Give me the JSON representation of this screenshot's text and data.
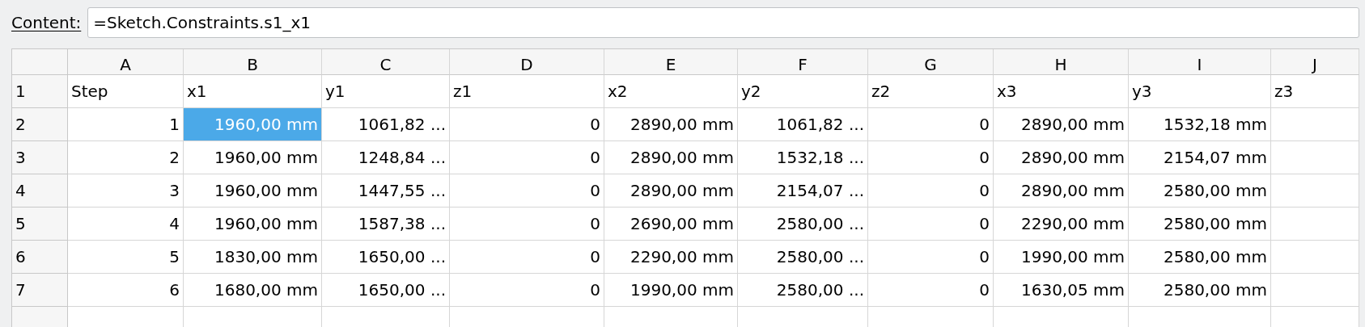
{
  "content_bar": {
    "label": "Content:",
    "value": "=Sketch.Constraints.s1_x1"
  },
  "table": {
    "columns": [
      "A",
      "B",
      "C",
      "D",
      "E",
      "F",
      "G",
      "H",
      "I",
      "J"
    ],
    "rows": [
      {
        "header": "1",
        "kind": "text",
        "cells": [
          {
            "text": "Step",
            "selected": false
          },
          {
            "text": "x1",
            "selected": false
          },
          {
            "text": "y1",
            "selected": false
          },
          {
            "text": "z1",
            "selected": false
          },
          {
            "text": "x2",
            "selected": false
          },
          {
            "text": "y2",
            "selected": false
          },
          {
            "text": "z2",
            "selected": false
          },
          {
            "text": "x3",
            "selected": false
          },
          {
            "text": "y3",
            "selected": false
          },
          {
            "text": "z3",
            "selected": false
          }
        ]
      },
      {
        "header": "2",
        "kind": "number",
        "cells": [
          {
            "text": "1",
            "selected": false
          },
          {
            "text": "1960,00 mm",
            "selected": true
          },
          {
            "text": "1061,82 ...",
            "selected": false
          },
          {
            "text": "0",
            "selected": false
          },
          {
            "text": "2890,00 mm",
            "selected": false
          },
          {
            "text": "1061,82 ...",
            "selected": false
          },
          {
            "text": "0",
            "selected": false
          },
          {
            "text": "2890,00 mm",
            "selected": false
          },
          {
            "text": "1532,18 mm",
            "selected": false
          }
        ]
      },
      {
        "header": "3",
        "kind": "number",
        "cells": [
          {
            "text": "2",
            "selected": false
          },
          {
            "text": "1960,00 mm",
            "selected": false
          },
          {
            "text": "1248,84 ...",
            "selected": false
          },
          {
            "text": "0",
            "selected": false
          },
          {
            "text": "2890,00 mm",
            "selected": false
          },
          {
            "text": "1532,18 ...",
            "selected": false
          },
          {
            "text": "0",
            "selected": false
          },
          {
            "text": "2890,00 mm",
            "selected": false
          },
          {
            "text": "2154,07 mm",
            "selected": false
          }
        ]
      },
      {
        "header": "4",
        "kind": "number",
        "cells": [
          {
            "text": "3",
            "selected": false
          },
          {
            "text": "1960,00 mm",
            "selected": false
          },
          {
            "text": "1447,55 ...",
            "selected": false
          },
          {
            "text": "0",
            "selected": false
          },
          {
            "text": "2890,00 mm",
            "selected": false
          },
          {
            "text": "2154,07 ...",
            "selected": false
          },
          {
            "text": "0",
            "selected": false
          },
          {
            "text": "2890,00 mm",
            "selected": false
          },
          {
            "text": "2580,00 mm",
            "selected": false
          }
        ]
      },
      {
        "header": "5",
        "kind": "number",
        "cells": [
          {
            "text": "4",
            "selected": false
          },
          {
            "text": "1960,00 mm",
            "selected": false
          },
          {
            "text": "1587,38 ...",
            "selected": false
          },
          {
            "text": "0",
            "selected": false
          },
          {
            "text": "2690,00 mm",
            "selected": false
          },
          {
            "text": "2580,00 ...",
            "selected": false
          },
          {
            "text": "0",
            "selected": false
          },
          {
            "text": "2290,00 mm",
            "selected": false
          },
          {
            "text": "2580,00 mm",
            "selected": false
          }
        ]
      },
      {
        "header": "6",
        "kind": "number",
        "cells": [
          {
            "text": "5",
            "selected": false
          },
          {
            "text": "1830,00 mm",
            "selected": false
          },
          {
            "text": "1650,00 ...",
            "selected": false
          },
          {
            "text": "0",
            "selected": false
          },
          {
            "text": "2290,00 mm",
            "selected": false
          },
          {
            "text": "2580,00 ...",
            "selected": false
          },
          {
            "text": "0",
            "selected": false
          },
          {
            "text": "1990,00 mm",
            "selected": false
          },
          {
            "text": "2580,00 mm",
            "selected": false
          }
        ]
      },
      {
        "header": "7",
        "kind": "number",
        "cells": [
          {
            "text": "6",
            "selected": false
          },
          {
            "text": "1680,00 mm",
            "selected": false
          },
          {
            "text": "1650,00 ...",
            "selected": false
          },
          {
            "text": "0",
            "selected": false
          },
          {
            "text": "1990,00 mm",
            "selected": false
          },
          {
            "text": "2580,00 ...",
            "selected": false
          },
          {
            "text": "0",
            "selected": false
          },
          {
            "text": "1630,05 mm",
            "selected": false
          },
          {
            "text": "2580,00 mm",
            "selected": false
          }
        ]
      }
    ]
  }
}
